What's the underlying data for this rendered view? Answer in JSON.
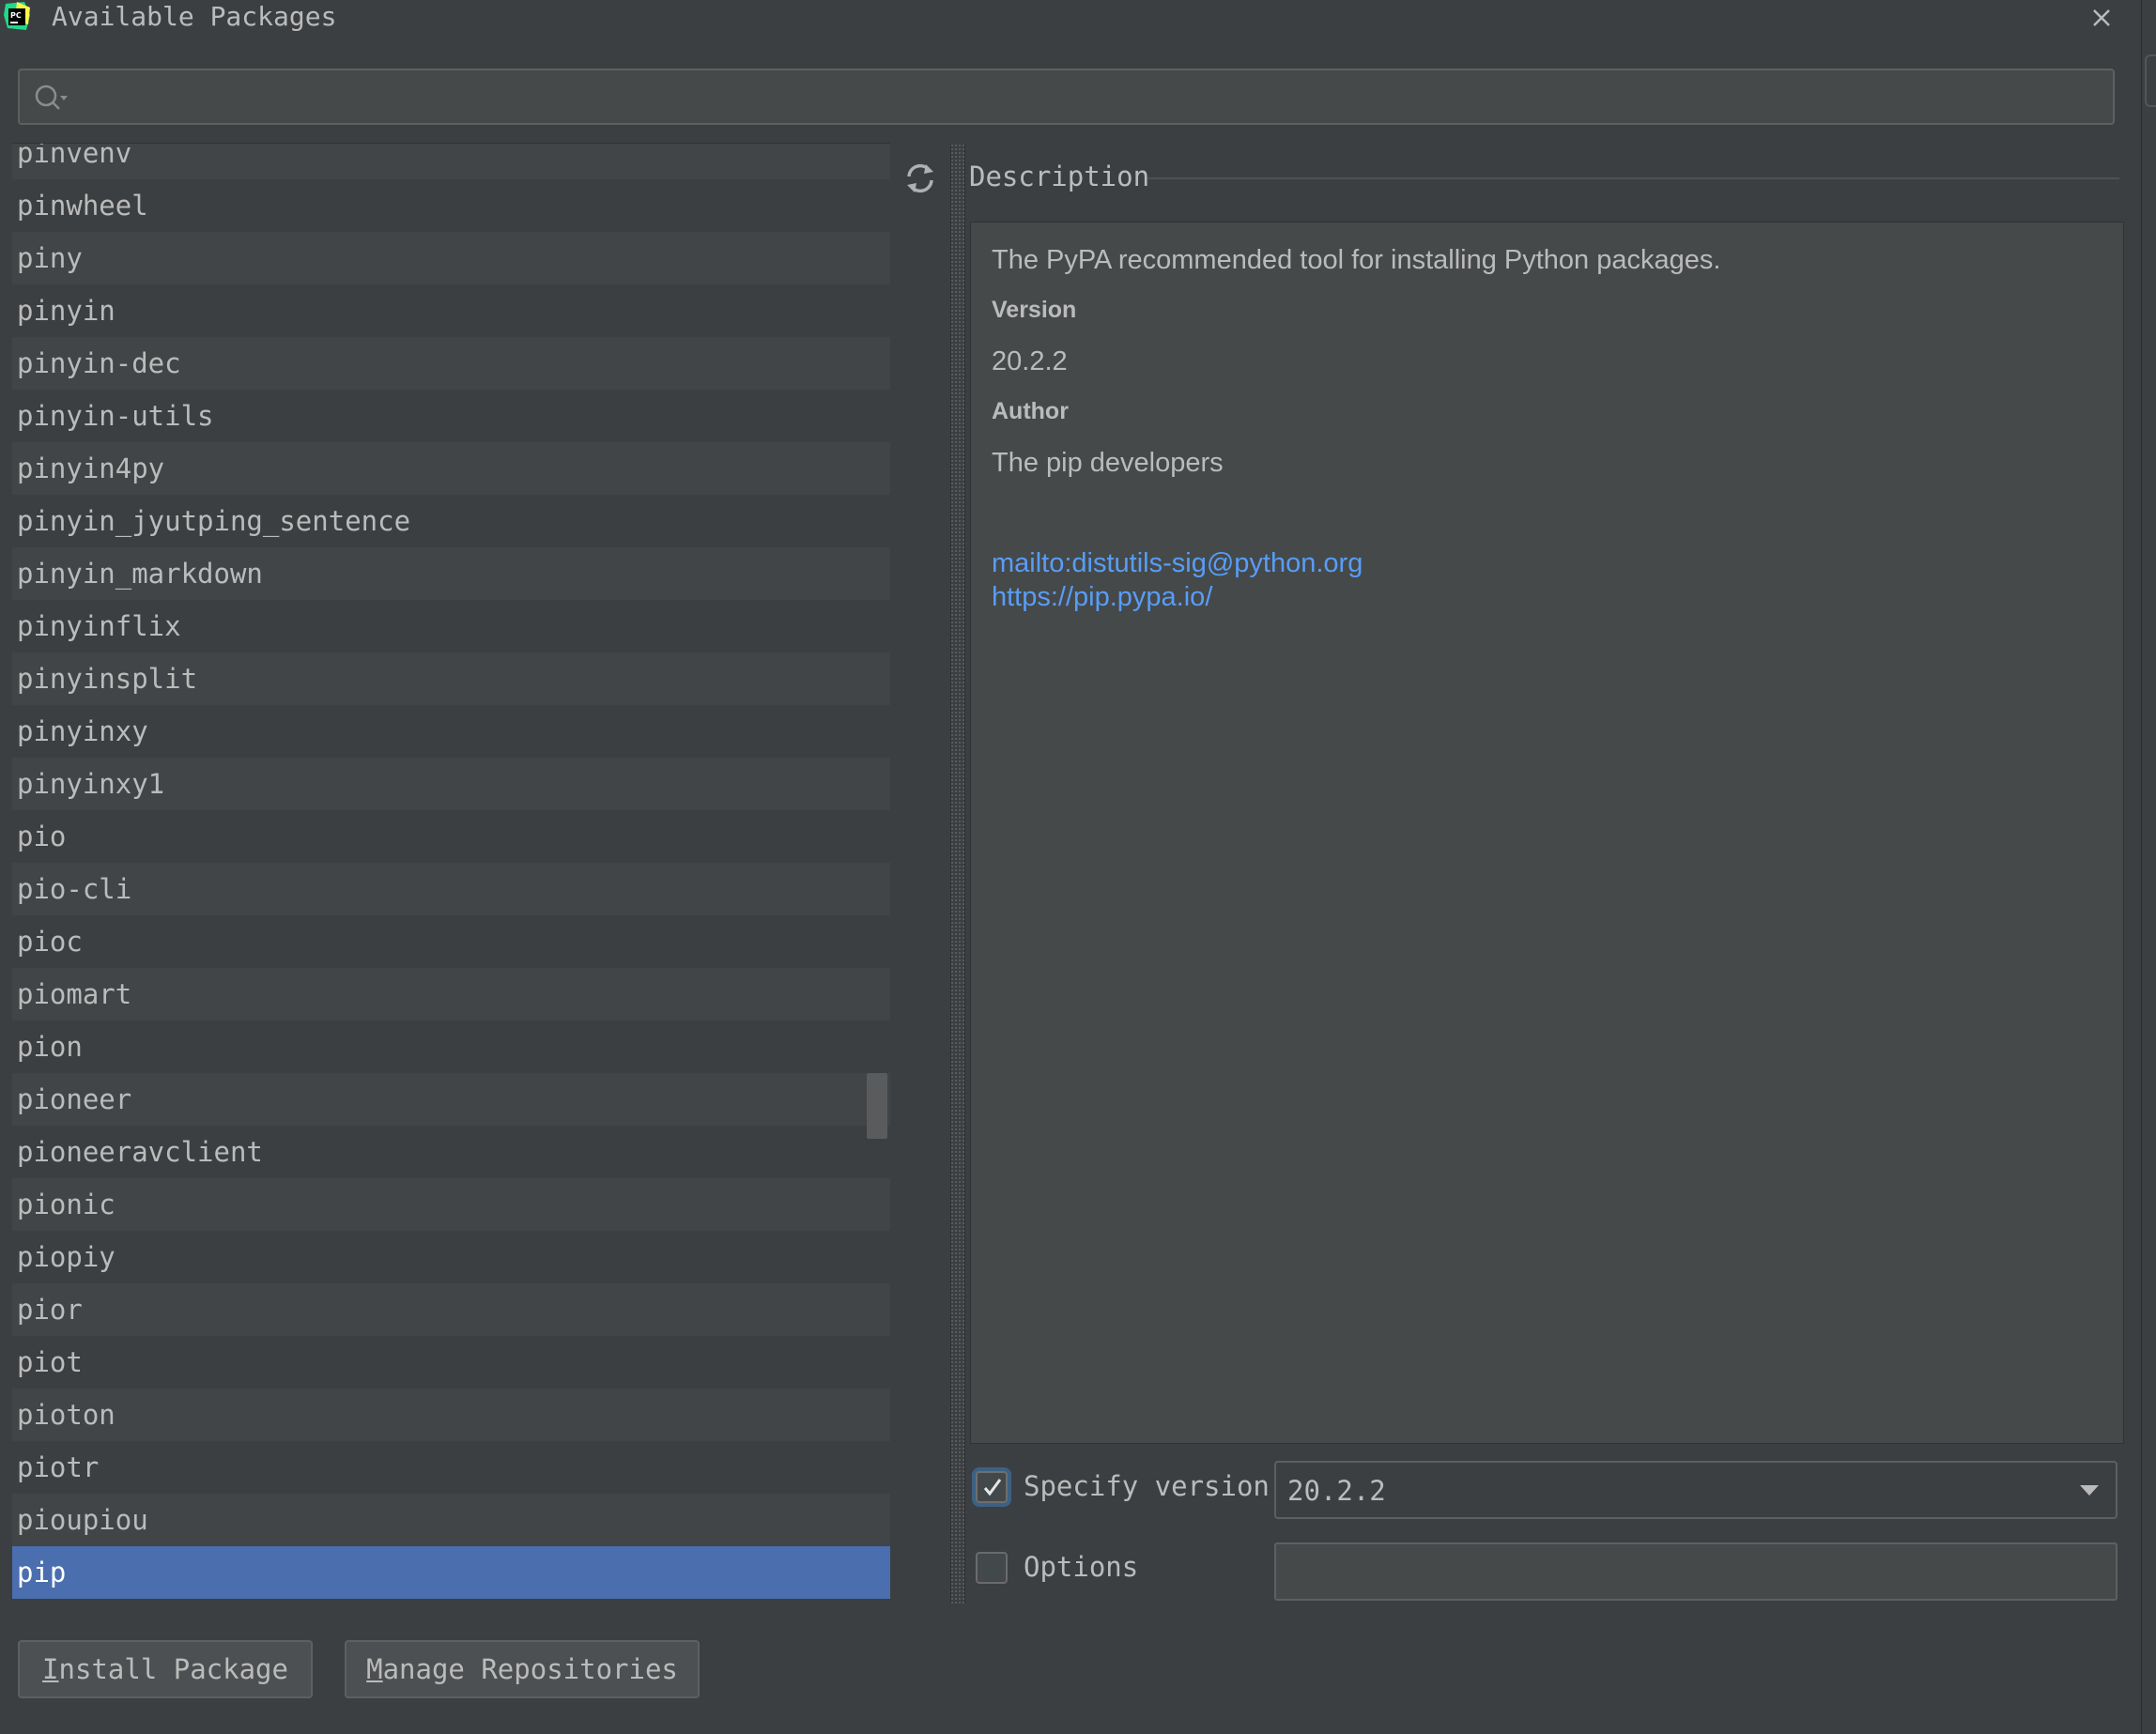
{
  "window": {
    "title": "Available Packages"
  },
  "search": {
    "value": "",
    "placeholder": ""
  },
  "packages": [
    "pinvenv",
    "pinwheel",
    "piny",
    "pinyin",
    "pinyin-dec",
    "pinyin-utils",
    "pinyin4py",
    "pinyin_jyutping_sentence",
    "pinyin_markdown",
    "pinyinflix",
    "pinyinsplit",
    "pinyinxy",
    "pinyinxy1",
    "pio",
    "pio-cli",
    "pioc",
    "piomart",
    "pion",
    "pioneer",
    "pioneeravclient",
    "pionic",
    "piopiy",
    "pior",
    "piot",
    "pioton",
    "piotr",
    "pioupiou",
    "pip"
  ],
  "selected_package": "pip",
  "description": {
    "section_label": "Description",
    "summary": "The PyPA recommended tool for installing Python packages.",
    "version_label": "Version",
    "version": "20.2.2",
    "author_label": "Author",
    "author": "The pip developers",
    "links": [
      "mailto:distutils-sig@python.org",
      "https://pip.pypa.io/"
    ]
  },
  "specify_version": {
    "label": "Specify version",
    "checked": true,
    "selected": "20.2.2"
  },
  "options": {
    "label": "Options",
    "checked": false,
    "value": ""
  },
  "buttons": {
    "install": {
      "mnemonic": "I",
      "rest": "nstall Package"
    },
    "manage": {
      "mnemonic": "M",
      "rest": "anage Repositories"
    }
  },
  "colors": {
    "background": "#3c3f41",
    "selection": "#4b6eaf",
    "link": "#589df6",
    "text": "#bbbbbb"
  },
  "icons": [
    "pycharm-app-icon",
    "close-icon",
    "search-icon",
    "refresh-icon",
    "checkmark-icon",
    "chevron-down-icon"
  ]
}
